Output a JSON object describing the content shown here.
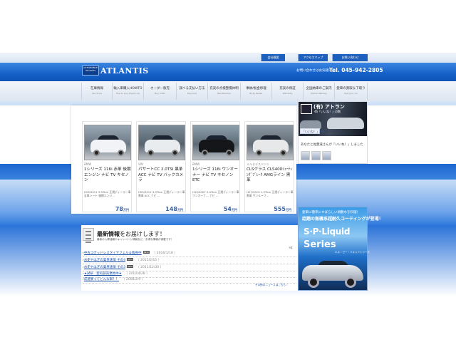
{
  "utility_links": [
    "会社概要",
    "アクセスマップ",
    "お問い合わせ"
  ],
  "header": {
    "logo_emblem": "AUTOMOBILE ATLANTIS",
    "brand": "ATLANTIS",
    "contact_prefix": "お問い合わせはお気軽に。",
    "tel": "Tel. 045-942-2805"
  },
  "nav": [
    {
      "jp": "在庫情報",
      "en": "Stock list"
    },
    {
      "jp": "輸入車購入HOWTO",
      "en": "How to buy import car"
    },
    {
      "jp": "オーダー販売",
      "en": "Buy order"
    },
    {
      "jp": "調べる支払い方法",
      "en": "Payment"
    },
    {
      "jp": "充実の点検整備体制",
      "en": "Maintenance"
    },
    {
      "jp": "事故/板金修理",
      "en": "Body Repair"
    },
    {
      "jp": "充実の保証",
      "en": "Warranty"
    },
    {
      "jp": "全国納車のご案内",
      "en": "Online delivery"
    },
    {
      "jp": "愛車の買取＆下取り",
      "en": "Sell your car"
    }
  ],
  "stock": [
    {
      "maker": "BMW",
      "model": "1シリーズ 116i 赤革 後期エンジン ナビ TV キセノン",
      "meta": "H23/2011 3.57km 正規ディーラー車 全車シート 後期エンジ…",
      "price": "78",
      "unit": "万円",
      "color": "#f1f3f6"
    },
    {
      "maker": "VW",
      "model": "パサートCC 2.0TSI 黒革 ACC ナビ TV バックカメラ",
      "meta": "H23/2011 3.37km 正規ディーラー車 黒革 ACC ナビ …",
      "price": "148",
      "unit": "万円",
      "color": "#e9ecef"
    },
    {
      "maker": "BMW",
      "model": "1シリーズ 116i ワンオーナー ナビ TV キセノン ETC",
      "meta": "H19/2007 2.47km 正規ディーラー車 ワンオーナ… ナビ …",
      "price": "54",
      "unit": "万円",
      "color": "#141619"
    },
    {
      "maker": "メルセデスベンツ",
      "model": "CLSクラス CLS400ｼｭｰﾃｨﾝｸﾞﾌﾞﾚｰｸ AMGライン 黒革",
      "meta": "H27/2015 1.37km 正規ディーラー車 黒革 サンルーフ…",
      "price": "555",
      "unit": "万円",
      "color": "#e6e8ea"
    }
  ],
  "facebook": {
    "page_name": "(有) アトラン",
    "page_sub": "46「いいね！」の数",
    "like_label": "「いいね！」済み",
    "friends_text": "あなたと佐賀道さんが「いいね！」しました"
  },
  "news": {
    "title_bold": "最新情報",
    "title_rest": "をお届けします！",
    "subtitle": "最新の入庫速報やキャンペーン情報など、お得な情報が満載です！",
    "count": "7件",
    "items": [
      {
        "title": "中古ゴグッドレスタイヤフェル＆販売中",
        "tag": "NEW",
        "date": "（ 2016/1/18 ）"
      },
      {
        "title": "お史やはぎの業界速情 その4",
        "tag": "NEW",
        "date": "（ 2015/2/15 ）"
      },
      {
        "title": "お史やはぎの業界速情 その3",
        "tag": "NEW",
        "date": "（ 2011/12/30 ）"
      },
      {
        "title": "★試研 : 愛的部売業始中★",
        "tag": "",
        "date": "（ 2010/4/28 ）"
      },
      {
        "title": "成選要ってどんな車？！",
        "tag": "",
        "date": "（ 2008/2/9 ）"
      }
    ],
    "more": "その他のニュースはこちら ›"
  },
  "ad": {
    "head1": "愛車に簡単にすばらしい頑艶水を料理！",
    "head2": "話題の無機系超耐久コーティングが登場！",
    "title1": "S·P·Liquid",
    "title2": "Series",
    "sub": "エス・ピー・リキッドシリーズ"
  },
  "colors": {
    "header_blue": "#1560c8",
    "price_blue": "#3a62a8",
    "link_blue": "#1a4fa8"
  }
}
